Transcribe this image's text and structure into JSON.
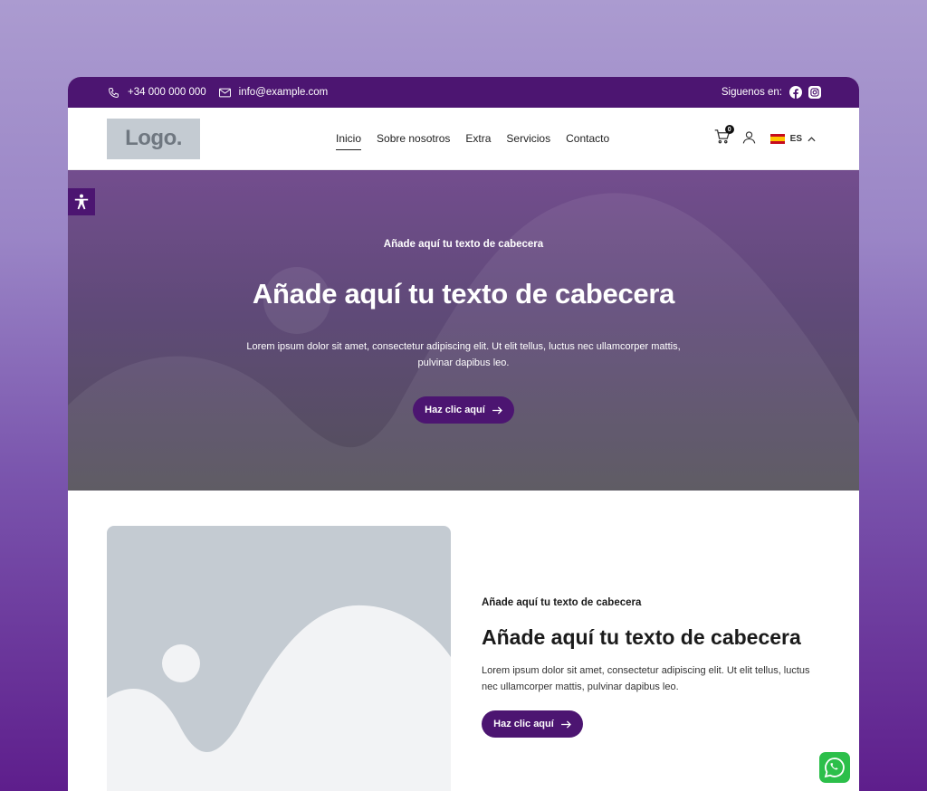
{
  "topbar": {
    "phone": "+34 000 000 000",
    "email": "info@example.com",
    "follow_label": "Siguenos en:",
    "social_icons": [
      "facebook-icon",
      "instagram-icon"
    ]
  },
  "nav": {
    "logo": "Logo.",
    "menu": [
      "Inicio",
      "Sobre nosotros",
      "Extra",
      "Servicios",
      "Contacto"
    ],
    "active_item": "Inicio",
    "cart_count": "0",
    "language": "ES"
  },
  "hero": {
    "subheading": "Añade aquí tu texto de cabecera",
    "heading": "Añade aquí tu texto de cabecera",
    "paragraph": "Lorem ipsum dolor sit amet, consectetur adipiscing elit. Ut elit tellus, luctus nec ullamcorper mattis, pulvinar dapibus leo.",
    "button": "Haz clic aquí"
  },
  "feature": {
    "subheading": "Añade aquí tu texto de cabecera",
    "heading": "Añade aquí tu texto de cabecera",
    "paragraph": "Lorem ipsum dolor sit amet, consectetur adipiscing elit. Ut elit tellus, luctus nec ullamcorper mattis, pulvinar dapibus leo.",
    "button": "Haz clic aquí"
  },
  "colors": {
    "brand": "#4c1571",
    "placeholder": "#c4cbd2",
    "whatsapp": "#2cbf4a"
  }
}
